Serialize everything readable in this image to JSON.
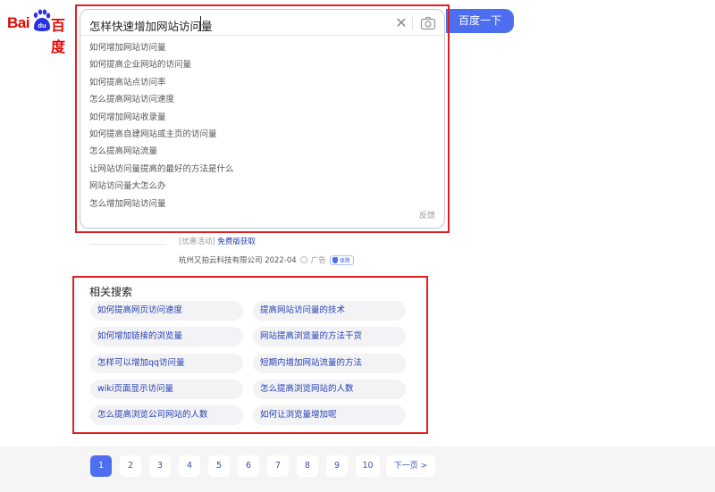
{
  "logo": {
    "bai": "Bai",
    "du": "du",
    "cn": "百度"
  },
  "search": {
    "query": "怎样快速增加网站访问量",
    "button_label": "百度一下",
    "clear_glyph": "✕",
    "feedback_label": "反馈",
    "suggestions": [
      "如何增加网站访问量",
      "如何提高企业网站的访问量",
      "如何提高站点访问率",
      "怎么提高网站访问速度",
      "如何增加网站收录量",
      "如何提高自建网站或主页的访问量",
      "怎么提高网站流量",
      "让网站访问量提高的最好的方法是什么",
      "网站访问量大怎么办",
      "怎么增加网站访问量"
    ]
  },
  "ad": {
    "tag": "[优惠活动]",
    "link_text": "免费版获取",
    "company_date": "杭州又拍云科技有限公司 2022-04",
    "ad_label": "广告",
    "badge": "保障"
  },
  "related": {
    "title": "相关搜索",
    "left": [
      "如何提高网页访问速度",
      "如何增加链接的浏览量",
      "怎样可以增加qq访问量",
      "wiki页面显示访问量",
      "怎么提高浏览公司网站的人数"
    ],
    "right": [
      "提高网站访问量的技术",
      "网站提高浏览量的方法干货",
      "短期内增加网站流量的方法",
      "怎么提高浏览网站的人数",
      "如何让浏览量增加呢"
    ]
  },
  "pager": {
    "pages": [
      "1",
      "2",
      "3",
      "4",
      "5",
      "6",
      "7",
      "8",
      "9",
      "10"
    ],
    "current": "1",
    "next_label": "下一页 >"
  },
  "colors": {
    "brand_red": "#e10602",
    "brand_blue": "#4e6ef2",
    "link_blue": "#2440b3",
    "annotation_red": "#e02020"
  }
}
